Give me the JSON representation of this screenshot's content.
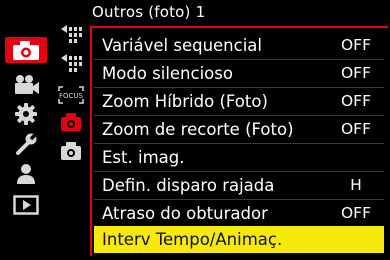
{
  "header": {
    "title": "Outros (foto) 1"
  },
  "menu": {
    "items": [
      {
        "label": "Variável sequencial",
        "value": "OFF"
      },
      {
        "label": "Modo silencioso",
        "value": "OFF"
      },
      {
        "label": "Zoom Híbrido (Foto)",
        "value": "OFF"
      },
      {
        "label": "Zoom de recorte (Foto)",
        "value": "OFF"
      },
      {
        "label": "Est. imag.",
        "value": ""
      },
      {
        "label": "Defin. disparo rajada",
        "value": "H"
      },
      {
        "label": "Atraso do obturador",
        "value": "OFF"
      },
      {
        "label": "Interv Tempo/Animaç.",
        "value": ""
      }
    ],
    "selected_index": 7
  },
  "sub_tabs": {
    "focus_label": "FOCUS"
  },
  "colors": {
    "accent": "#e60012",
    "highlight": "#f7e90a",
    "background": "#000000"
  },
  "icons": {
    "main": [
      "camera-icon",
      "video-camera-icon",
      "gear-icon",
      "wrench-icon",
      "person-icon",
      "playback-icon"
    ],
    "sub": [
      "stacked-arrows-icon",
      "stacked-arrows-icon",
      "focus-icon",
      "camera-small-icon",
      "camera-small-icon"
    ]
  }
}
